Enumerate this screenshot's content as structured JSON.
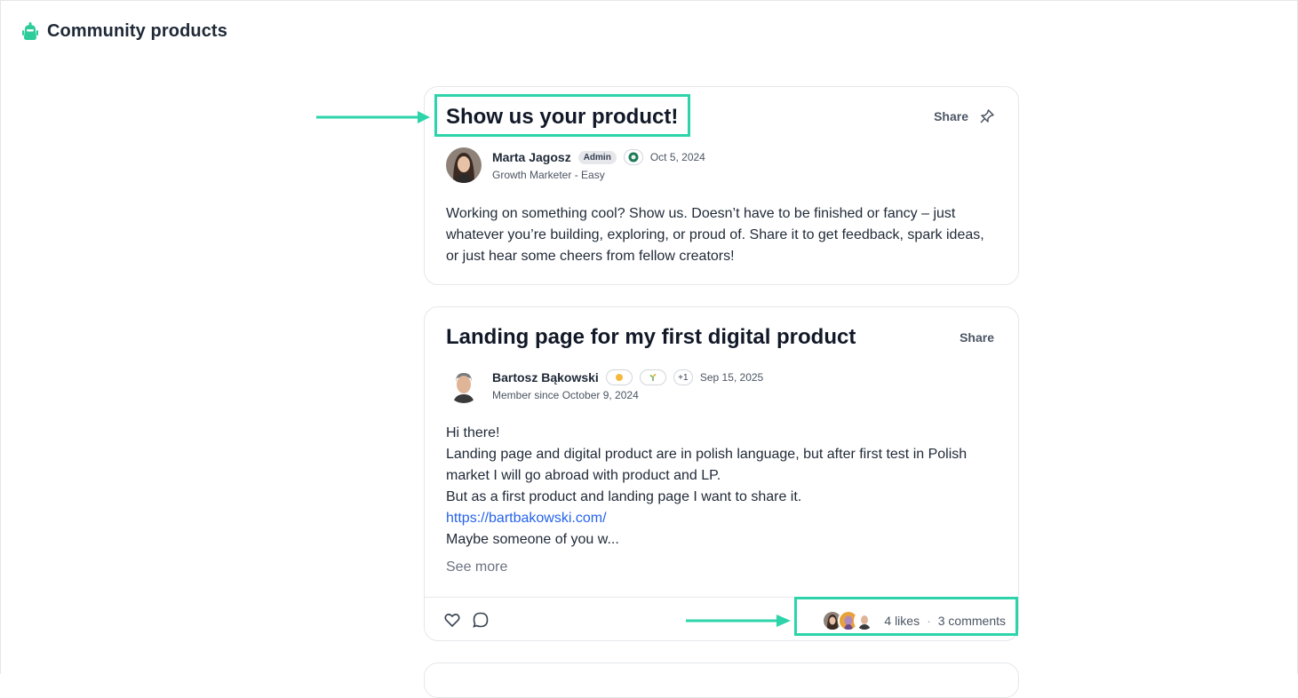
{
  "header": {
    "title": "Community products",
    "icon": "community-bot-icon",
    "accent": "#2ecc9a"
  },
  "posts": [
    {
      "title": "Show us your product!",
      "share_label": "Share",
      "author": {
        "name": "Marta Jagosz",
        "role_badge": "Admin",
        "subtitle": "Growth Marketer - Easy"
      },
      "date": "Oct 5, 2024",
      "body": [
        "Working on something cool? Show us. Doesn’t have to be finished or fancy – just whatever you’re building, exploring, or proud of. Share it to get feedback, spark ideas, or just hear some cheers from fellow creators!"
      ]
    },
    {
      "title": "Landing page for my first digital product",
      "share_label": "Share",
      "author": {
        "name": "Bartosz Bąkowski",
        "extra_badges": "+1",
        "subtitle": "Member since October 9, 2024"
      },
      "date": "Sep 15, 2025",
      "body": [
        "Hi there!",
        "Landing page and digital product are in polish language, but after first test in Polish market I will go abroad with product and LP.",
        "But as a first product and landing page I want to share it.",
        "https://bartbakowski.com/",
        "Maybe someone of you w..."
      ],
      "see_more": "See more",
      "likes": "4 likes",
      "separator": "·",
      "comments": "3 comments"
    }
  ],
  "annotation_color": "#2dd4aa"
}
